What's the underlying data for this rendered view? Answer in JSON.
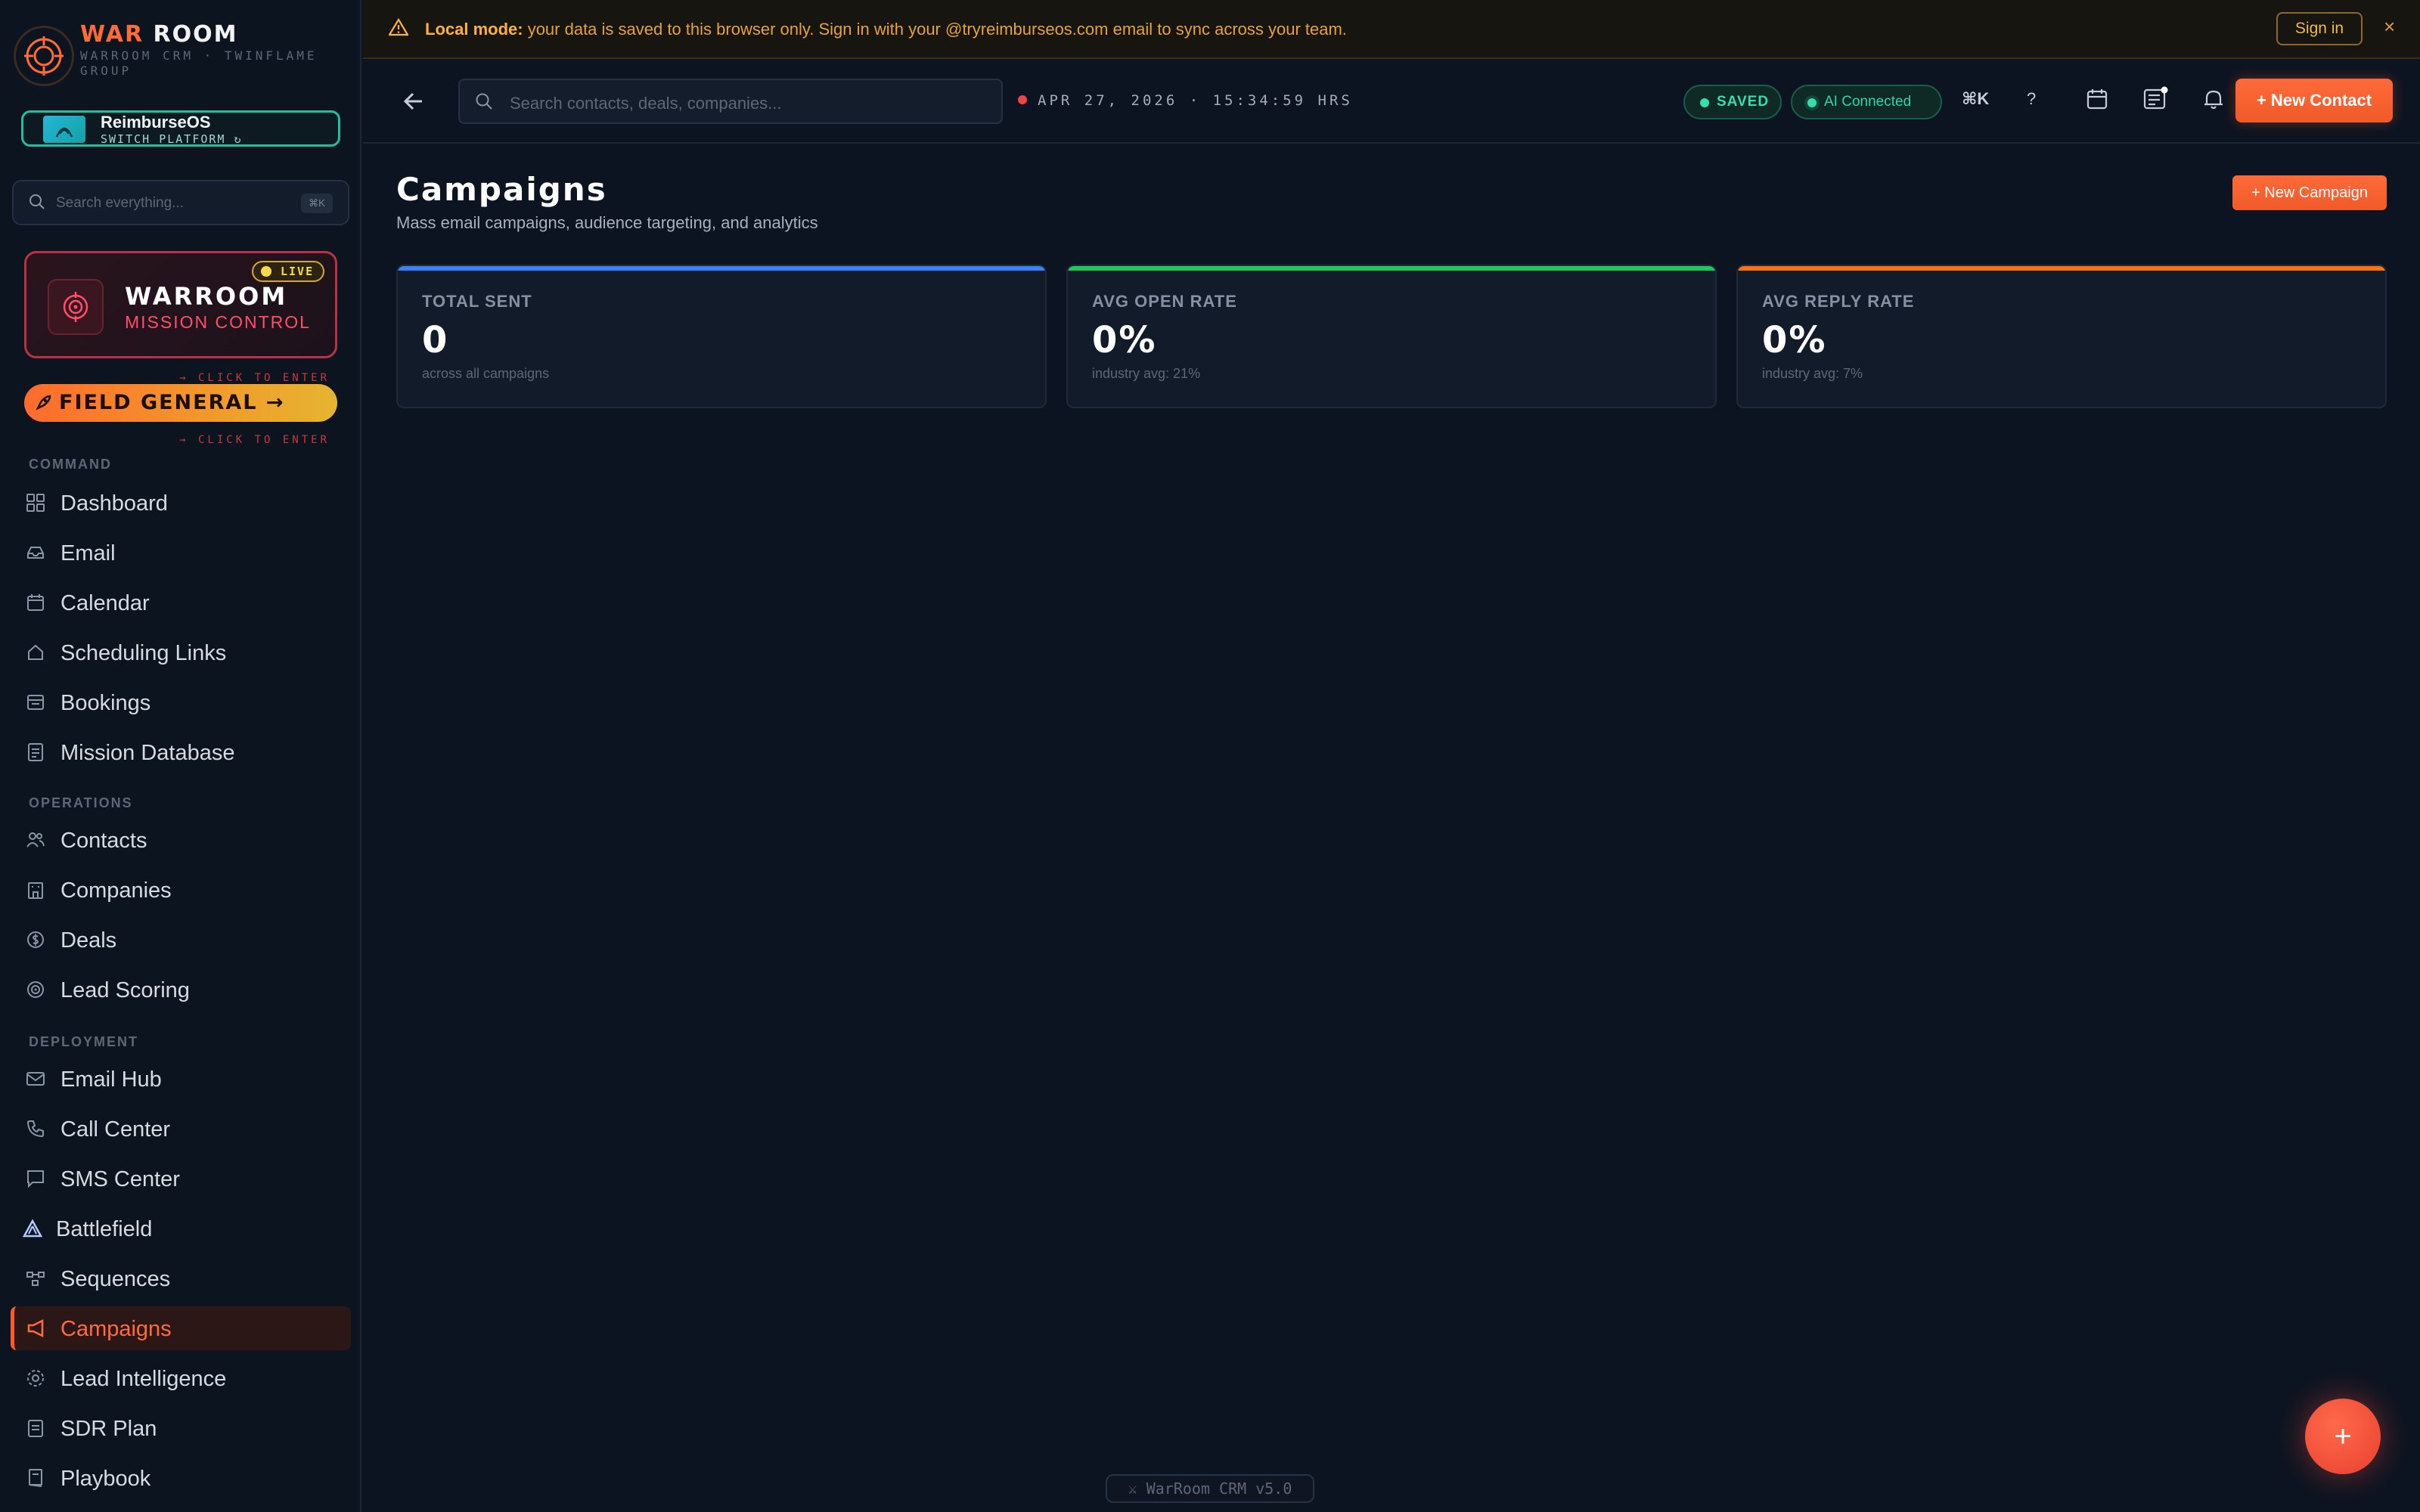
{
  "brand": {
    "title_accent": "WAR",
    "title_rest": " ROOM",
    "subtitle": "WARROOM CRM · TWINFLAME GROUP"
  },
  "platform": {
    "name": "ReimburseOS",
    "switch_label": "SWITCH PLATFORM ↻"
  },
  "sidebar_search": {
    "placeholder": "Search everything...",
    "shortcut": "⌘K"
  },
  "mission": {
    "badge": "LIVE",
    "title": "WARROOM",
    "subtitle": "MISSION CONTROL",
    "hint": "→ CLICK TO ENTER"
  },
  "field_general": {
    "label": "FIELD GENERAL →",
    "hint": "→ CLICK TO ENTER"
  },
  "nav": {
    "command": {
      "title": "COMMAND",
      "items": [
        "Dashboard",
        "Email",
        "Calendar",
        "Scheduling Links",
        "Bookings",
        "Mission Database"
      ]
    },
    "operations": {
      "title": "OPERATIONS",
      "items": [
        "Contacts",
        "Companies",
        "Deals",
        "Lead Scoring"
      ]
    },
    "deployment": {
      "title": "DEPLOYMENT",
      "items": [
        "Email Hub",
        "Call Center",
        "SMS Center",
        "Battlefield",
        "Sequences",
        "Campaigns",
        "Lead Intelligence",
        "SDR Plan",
        "Playbook"
      ]
    },
    "active": "Campaigns"
  },
  "banner": {
    "strong": "Local mode:",
    "text": " your data is saved to this browser only. Sign in with your @tryreimburseos.com email to sync across your team.",
    "signin": "Sign in",
    "close": "×"
  },
  "topbar": {
    "search_placeholder": "Search contacts, deals, companies...",
    "clock": "APR 27, 2026 · 15:34:59 HRS",
    "saved": "SAVED",
    "ai": "AI Connected",
    "shortcut": "⌘K",
    "help": "?",
    "new_contact": "+ New Contact"
  },
  "page": {
    "title": "Campaigns",
    "subtitle": "Mass email campaigns, audience targeting, and analytics",
    "new_campaign": "+ New Campaign"
  },
  "stats": [
    {
      "label": "TOTAL SENT",
      "value": "0",
      "note": "across all campaigns",
      "color": "#3b82f6"
    },
    {
      "label": "AVG OPEN RATE",
      "value": "0%",
      "note": "industry avg: 21%",
      "color": "#22c55e"
    },
    {
      "label": "AVG REPLY RATE",
      "value": "0%",
      "note": "industry avg: 7%",
      "color": "#f97316"
    }
  ],
  "footer": {
    "version": "⚔ WarRoom CRM v5.0"
  },
  "fab": "+",
  "colors": {
    "accent": "#ff6b35",
    "background": "#0d1421",
    "success": "#34e0a8",
    "danger": "#ef4444"
  }
}
